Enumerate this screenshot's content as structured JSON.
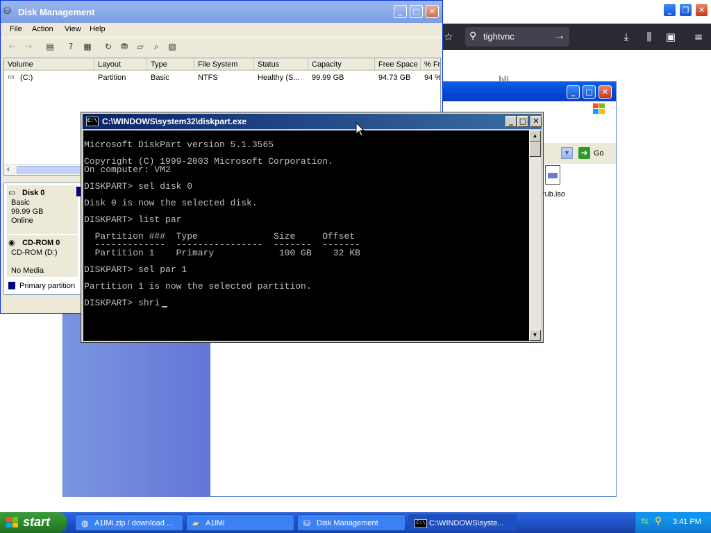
{
  "firefox": {
    "search_value": "tightvnc",
    "content_partial": "...bli..."
  },
  "explorer": {
    "go_label": "Go",
    "file_label": "rub.iso"
  },
  "disk_management": {
    "title": "Disk Management",
    "menu": [
      "File",
      "Action",
      "View",
      "Help"
    ],
    "columns": [
      "Volume",
      "Layout",
      "Type",
      "File System",
      "Status",
      "Capacity",
      "Free Space",
      "% Fr"
    ],
    "rows": [
      {
        "volume": "(C:)",
        "layout": "Partition",
        "type": "Basic",
        "file_system": "NTFS",
        "status": "Healthy (S...",
        "capacity": "99.99 GB",
        "free_space": "94.73 GB",
        "pct_free": "94 %"
      }
    ],
    "disks": [
      {
        "name": "Disk 0",
        "line1": "Basic",
        "line2": "99.99 GB",
        "line3": "Online"
      },
      {
        "name": "CD-ROM 0",
        "line1": "CD-ROM (D:)",
        "line2": "",
        "line3": "No Media"
      }
    ],
    "legend": "Primary partition"
  },
  "console": {
    "title": "C:\\WINDOWS\\system32\\diskpart.exe",
    "lines": [
      "Microsoft DiskPart version 5.1.3565",
      "",
      "Copyright (C) 1999-2003 Microsoft Corporation.",
      "On computer: VM2",
      "",
      "DISKPART> sel disk 0",
      "",
      "Disk 0 is now the selected disk.",
      "",
      "DISKPART> list par",
      "",
      "  Partition ###  Type              Size     Offset",
      "  -------------  ----------------  -------  -------",
      "  Partition 1    Primary            100 GB    32 KB",
      "",
      "DISKPART> sel par 1",
      "",
      "Partition 1 is now the selected partition.",
      "",
      "DISKPART> shri"
    ]
  },
  "taskbar": {
    "start_label": "start",
    "tasks": [
      {
        "label": "A1lMi.zip / download ..."
      },
      {
        "label": "A1lMi"
      },
      {
        "label": "Disk Management"
      },
      {
        "label": "C:\\WINDOWS\\syste..."
      }
    ],
    "clock": "3:41 PM"
  },
  "colors": {
    "xp_blue": "#0a5fe9",
    "taskbar": "#245edb",
    "start_green": "#2f8f2f",
    "console_bg": "#000000",
    "console_fg": "#c0c0c0"
  }
}
